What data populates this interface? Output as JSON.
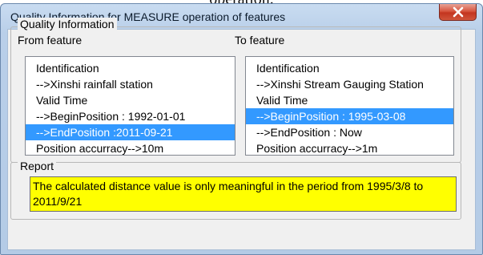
{
  "caption": "operation.",
  "window": {
    "title": "Quality Information for MEASURE operation of features",
    "close_icon": "close-x-icon"
  },
  "quality_group": {
    "legend": "Quality Information",
    "from_label": "From feature",
    "to_label": "To feature",
    "from_items": [
      "Identification",
      "-->Xinshi rainfall station",
      "Valid Time",
      "-->BeginPosition : 1992-01-01",
      "-->EndPosition :2011-09-21",
      "Position accurracy-->10m"
    ],
    "from_selected_index": 4,
    "to_items": [
      "Identification",
      "-->Xinshi Stream Gauging Station",
      "Valid Time",
      "-->BeginPosition : 1995-03-08",
      "-->EndPosition : Now",
      "Position accurracy-->1m"
    ],
    "to_selected_index": 3
  },
  "report_group": {
    "legend": "Report",
    "text": "The calculated distance value is only meaningful in the period from 1995/3/8 to 2011/9/21"
  },
  "colors": {
    "selection": "#3399ff",
    "report_background": "#ffff00",
    "close_button": "#c9402a"
  }
}
